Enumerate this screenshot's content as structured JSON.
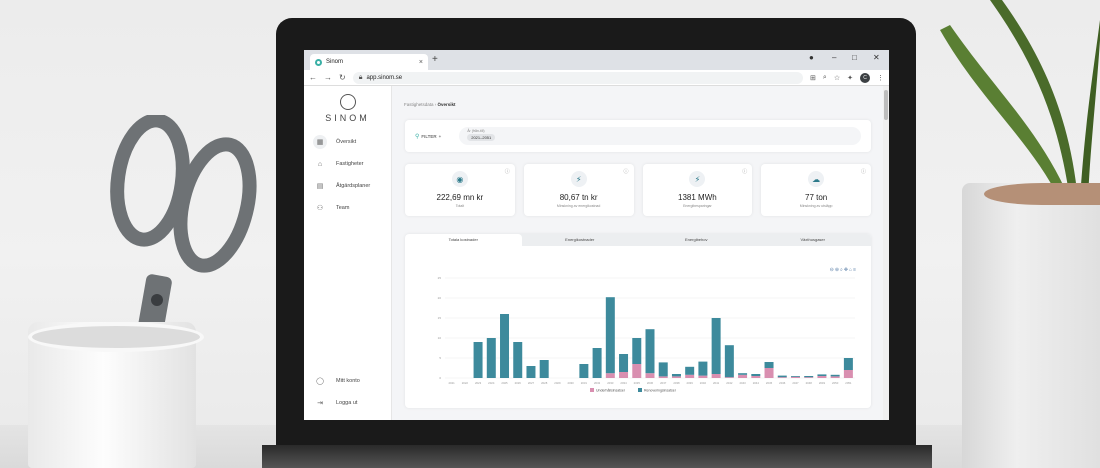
{
  "browser": {
    "tab_title": "Sinom",
    "url": "app.sinom.se",
    "profile_initial": "C"
  },
  "sidebar": {
    "logo_text": "SINOM",
    "items": [
      {
        "label": "Översikt",
        "icon": "grid-icon",
        "active": true
      },
      {
        "label": "Fastigheter",
        "icon": "building-icon",
        "active": false
      },
      {
        "label": "Åtgärdsplaner",
        "icon": "calendar-icon",
        "active": false
      },
      {
        "label": "Team",
        "icon": "team-icon",
        "active": false
      }
    ],
    "bottom_items": [
      {
        "label": "Mitt konto",
        "icon": "user-icon"
      },
      {
        "label": "Logga ut",
        "icon": "logout-icon"
      }
    ]
  },
  "breadcrumb": {
    "parent": "Fastighetsdata",
    "current": "Översikt"
  },
  "filter": {
    "button_label": "FILTER",
    "chip_label": "År (från-till)",
    "chip_value": "2021–2051"
  },
  "kpis": [
    {
      "value": "222,69 mn kr",
      "label": "Totalt",
      "icon": "coins-icon"
    },
    {
      "value": "80,67 tn kr",
      "label": "Minskning av energikostnad",
      "icon": "bolt-icon"
    },
    {
      "value": "1381 MWh",
      "label": "Energibesparingar",
      "icon": "bolt-icon"
    },
    {
      "value": "77 ton",
      "label": "Minskning av utsläpp",
      "icon": "emission-icon"
    }
  ],
  "chart_tabs": [
    "Totala kostnader",
    "Energikostnader",
    "Energibehov",
    "Växthusgaser"
  ],
  "chart_data": {
    "type": "bar",
    "stacked": true,
    "categories": [
      "2021",
      "2022",
      "2023",
      "2024",
      "2025",
      "2026",
      "2027",
      "2028",
      "2029",
      "2030",
      "2031",
      "2032",
      "2033",
      "2034",
      "2035",
      "2036",
      "2037",
      "2038",
      "2039",
      "2040",
      "2041",
      "2042",
      "2043",
      "2044",
      "2045",
      "2046",
      "2047",
      "2048",
      "2049",
      "2050",
      "2051"
    ],
    "series": [
      {
        "name": "Underhållsinsatser",
        "color": "#d98fb0",
        "values": [
          0,
          0,
          0,
          0,
          0,
          0,
          0,
          0,
          0,
          0,
          0,
          0,
          1.2,
          1.5,
          3.5,
          1.2,
          0.4,
          0.4,
          0.8,
          0.6,
          1.0,
          0.2,
          0.8,
          0.5,
          2.5,
          0.2,
          0.3,
          0.2,
          0.5,
          0.4,
          2.0
        ]
      },
      {
        "name": "Renoveringsinsatser",
        "color": "#3d8a9c",
        "values": [
          0,
          0,
          9,
          10,
          16,
          9,
          3,
          4.5,
          0,
          0,
          3.5,
          7.5,
          19,
          4.5,
          6.5,
          11,
          3.5,
          0.6,
          2,
          3.5,
          14,
          8,
          0.4,
          0.5,
          1.5,
          0.4,
          0.2,
          0.3,
          0.4,
          0.4,
          3
        ]
      }
    ],
    "ylim": [
      0,
      25
    ]
  }
}
